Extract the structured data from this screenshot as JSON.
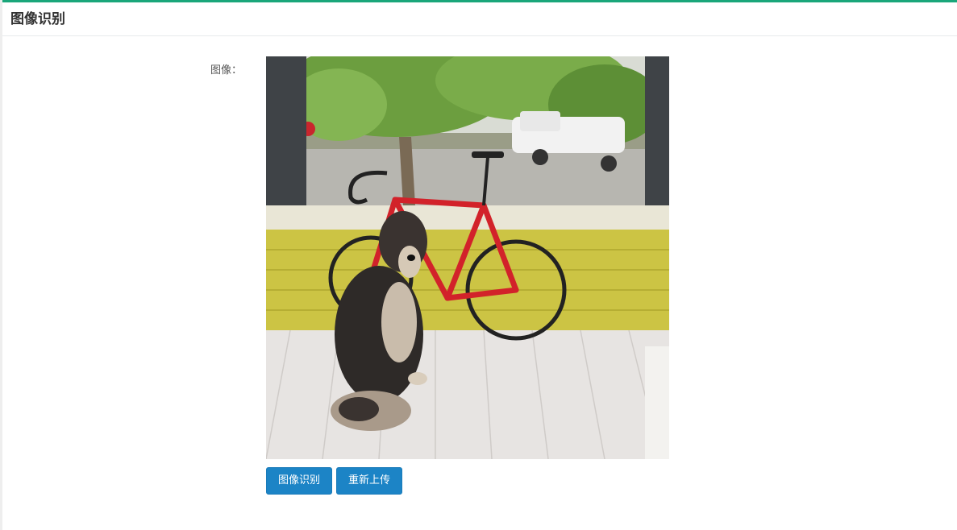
{
  "header": {
    "title": "图像识别"
  },
  "form": {
    "image_label": "图像："
  },
  "actions": {
    "recognize_label": "图像识别",
    "reupload_label": "重新上传"
  },
  "colors": {
    "accent_top_border": "#1aa67a",
    "button_primary": "#1c84c6"
  }
}
